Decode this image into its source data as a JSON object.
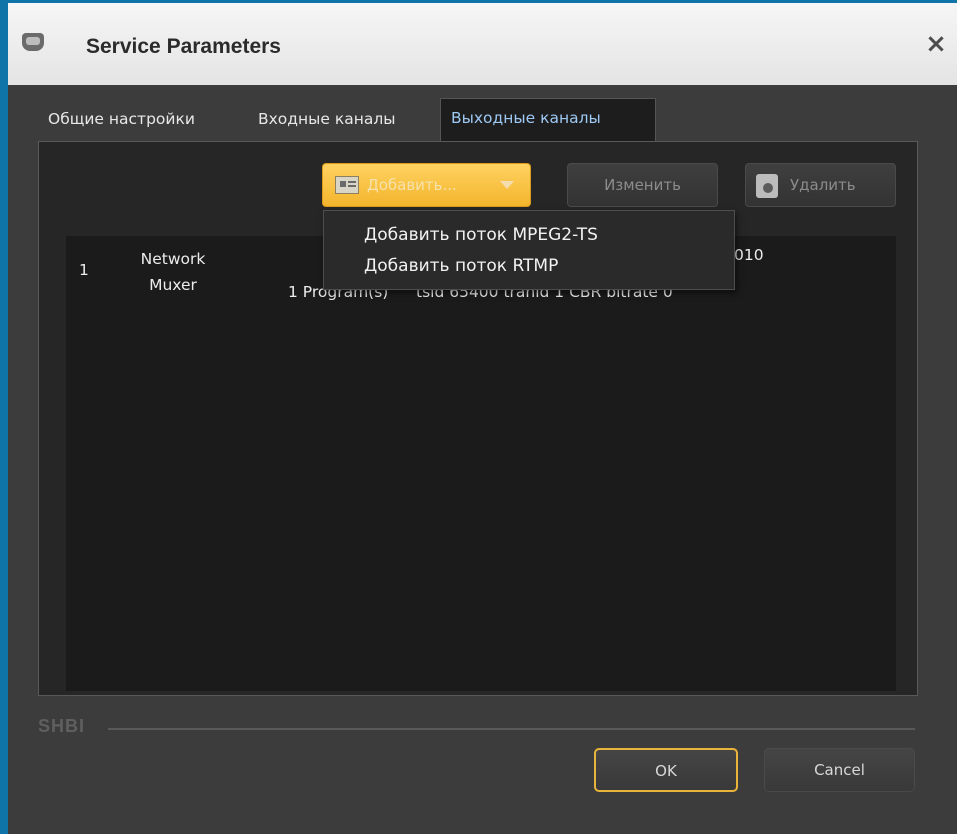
{
  "window": {
    "title": "Service Parameters",
    "app_icon": "app-icon",
    "close_icon": "close-icon",
    "close_glyph": "×"
  },
  "tabs": [
    {
      "label": "Общие настройки",
      "selected": false
    },
    {
      "label": "Входные каналы",
      "selected": false
    },
    {
      "label": "Выходные каналы",
      "selected": true
    }
  ],
  "toolbar": {
    "add_label": "Добавить...",
    "add_icon": "add-stream-icon",
    "dropdown_icon": "chevron-down-icon",
    "edit_label": "Изменить",
    "delete_label": "Удалить",
    "delete_icon": "trash-icon"
  },
  "list": {
    "rows": [
      {
        "index": "1",
        "type": "Network Muxer",
        "programs": "1 Program(s)",
        "description_top": "010",
        "description": "tsid 65400 tranid 1 CBR bitrate 0"
      }
    ]
  },
  "add_menu": {
    "items": [
      "Добавить поток MPEG2-TS",
      "Добавить поток RTMP"
    ]
  },
  "footer": {
    "logo": "SHBI",
    "ok_label": "OK",
    "cancel_label": "Cancel"
  },
  "colors": {
    "accent": "#f3b52d",
    "window_border": "#0f75a8",
    "selected_tab_text": "#9ec9f4"
  }
}
